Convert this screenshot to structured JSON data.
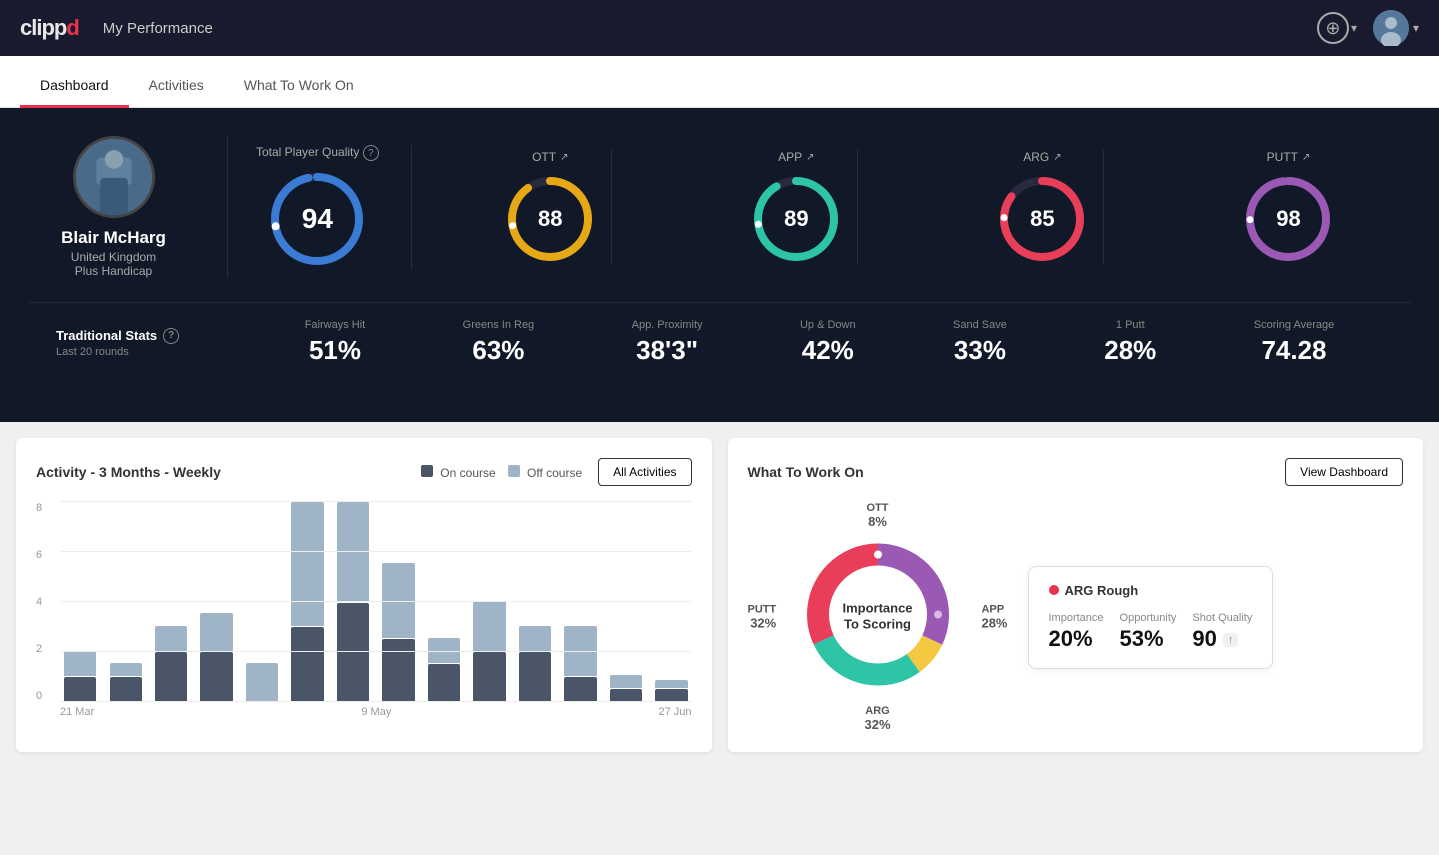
{
  "app": {
    "logo_clip": "clipp",
    "logo_d": "d",
    "title": "My Performance"
  },
  "nav": {
    "add_label": "+",
    "chevron": "▾"
  },
  "tabs": [
    {
      "id": "dashboard",
      "label": "Dashboard",
      "active": true
    },
    {
      "id": "activities",
      "label": "Activities",
      "active": false
    },
    {
      "id": "what-to-work-on",
      "label": "What To Work On",
      "active": false
    }
  ],
  "player": {
    "name": "Blair McHarg",
    "country": "United Kingdom",
    "handicap": "Plus Handicap"
  },
  "scores": {
    "total_label": "Total Player Quality",
    "total_value": "94",
    "items": [
      {
        "label": "OTT",
        "value": "88",
        "color": "#e6a817"
      },
      {
        "label": "APP",
        "value": "89",
        "color": "#2ec4a6"
      },
      {
        "label": "ARG",
        "value": "85",
        "color": "#e83e5a"
      },
      {
        "label": "PUTT",
        "value": "98",
        "color": "#9b59b6"
      }
    ]
  },
  "traditional_stats": {
    "label": "Traditional Stats",
    "sublabel": "Last 20 rounds",
    "items": [
      {
        "label": "Fairways Hit",
        "value": "51%"
      },
      {
        "label": "Greens In Reg",
        "value": "63%"
      },
      {
        "label": "App. Proximity",
        "value": "38'3\""
      },
      {
        "label": "Up & Down",
        "value": "42%"
      },
      {
        "label": "Sand Save",
        "value": "33%"
      },
      {
        "label": "1 Putt",
        "value": "28%"
      },
      {
        "label": "Scoring Average",
        "value": "74.28"
      }
    ]
  },
  "activity_chart": {
    "title": "Activity - 3 Months - Weekly",
    "legend_on": "On course",
    "legend_off": "Off course",
    "all_activities_btn": "All Activities",
    "y_labels": [
      "0",
      "2",
      "4",
      "6",
      "8"
    ],
    "x_labels": [
      "21 Mar",
      "9 May",
      "27 Jun"
    ],
    "bars": [
      {
        "on": 1,
        "off": 1
      },
      {
        "on": 1,
        "off": 0.5
      },
      {
        "on": 2,
        "off": 1
      },
      {
        "on": 2,
        "off": 1.5
      },
      {
        "on": 0,
        "off": 1.5
      },
      {
        "on": 3,
        "off": 5
      },
      {
        "on": 4,
        "off": 4
      },
      {
        "on": 2.5,
        "off": 3
      },
      {
        "on": 1.5,
        "off": 1
      },
      {
        "on": 2,
        "off": 2
      },
      {
        "on": 2,
        "off": 1
      },
      {
        "on": 1,
        "off": 2
      },
      {
        "on": 0.5,
        "off": 0.5
      },
      {
        "on": 0.5,
        "off": 0.3
      }
    ]
  },
  "what_to_work_on": {
    "title": "What To Work On",
    "view_dashboard_btn": "View Dashboard",
    "donut_center": "Importance\nTo Scoring",
    "segments": [
      {
        "label": "OTT",
        "pct": "8%",
        "color": "#f5c842",
        "pos": "top"
      },
      {
        "label": "APP",
        "pct": "28%",
        "color": "#2ec4a6",
        "pos": "right"
      },
      {
        "label": "ARG",
        "pct": "32%",
        "color": "#e83e5a",
        "pos": "bottom"
      },
      {
        "label": "PUTT",
        "pct": "32%",
        "color": "#9b59b6",
        "pos": "left"
      }
    ],
    "info_card": {
      "title": "ARG Rough",
      "metrics": [
        {
          "label": "Importance",
          "value": "20%"
        },
        {
          "label": "Opportunity",
          "value": "53%"
        },
        {
          "label": "Shot Quality",
          "value": "90",
          "tag": ""
        }
      ]
    }
  }
}
